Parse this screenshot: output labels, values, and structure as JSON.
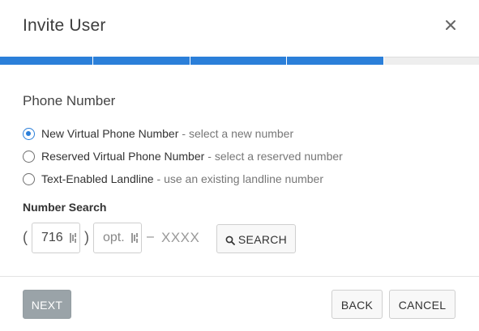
{
  "dialog": {
    "title": "Invite User",
    "close_icon": "close-icon",
    "progress": {
      "total_steps": 5,
      "completed_steps": 4,
      "accent": "#2b7fd9"
    }
  },
  "phone_section": {
    "title": "Phone Number",
    "options": [
      {
        "label": "New Virtual Phone Number",
        "description": "- select a new number",
        "selected": true
      },
      {
        "label": "Reserved Virtual Phone Number",
        "description": "- select a reserved number",
        "selected": false
      },
      {
        "label": "Text-Enabled Landline",
        "description": "- use an existing landline number",
        "selected": false
      }
    ]
  },
  "number_search": {
    "label": "Number Search",
    "open_paren": "(",
    "close_paren": ")",
    "area_code_value": "716",
    "prefix_placeholder": "opt.",
    "dash": "–",
    "suffix": "XXXX",
    "search_label": "SEARCH",
    "search_icon": "search-icon"
  },
  "footer": {
    "next_label": "NEXT",
    "back_label": "BACK",
    "cancel_label": "CANCEL",
    "next_color": "#9aa3a8"
  }
}
